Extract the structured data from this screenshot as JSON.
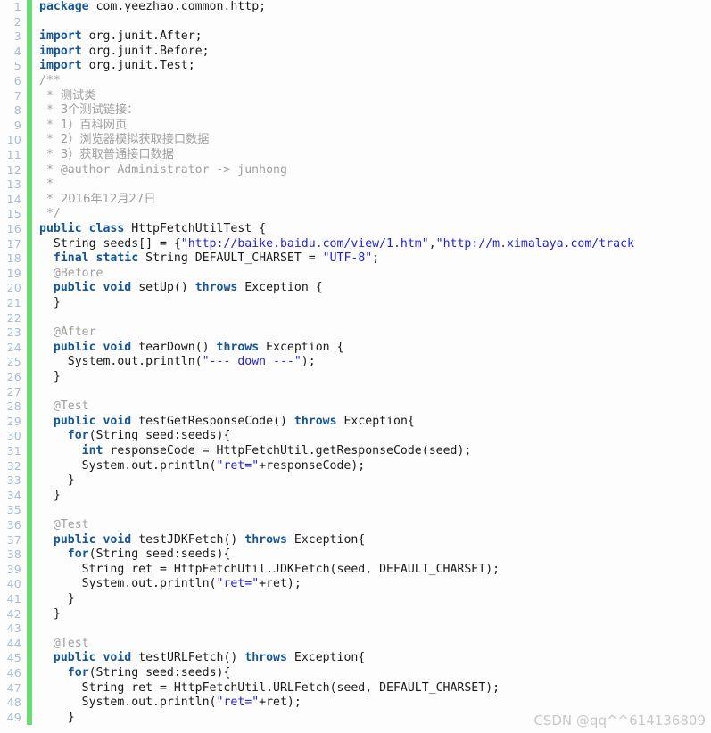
{
  "editor": {
    "language": "java",
    "gutter_accent_color": "#6bdc72",
    "background_color": "#fdfdfd",
    "line_number_color": "#a8bdd0",
    "keyword_color": "#14559a",
    "string_color": "#2121e8",
    "comment_color": "#a0a0a0",
    "text_color": "#1a1a1a",
    "first_line": 1,
    "last_line": 49
  },
  "watermark": {
    "text": "CSDN @qq^^614136809"
  },
  "lines": [
    {
      "n": "1",
      "tokens": [
        {
          "t": "kw",
          "v": "package"
        },
        {
          "t": "plain",
          "v": " com.yeezhao.common.http;"
        }
      ]
    },
    {
      "n": "2",
      "tokens": [
        {
          "t": "plain",
          "v": ""
        }
      ]
    },
    {
      "n": "3",
      "tokens": [
        {
          "t": "kw",
          "v": "import"
        },
        {
          "t": "plain",
          "v": " org.junit.After;"
        }
      ]
    },
    {
      "n": "4",
      "tokens": [
        {
          "t": "kw",
          "v": "import"
        },
        {
          "t": "plain",
          "v": " org.junit.Before;"
        }
      ]
    },
    {
      "n": "5",
      "tokens": [
        {
          "t": "kw",
          "v": "import"
        },
        {
          "t": "plain",
          "v": " org.junit.Test;"
        }
      ]
    },
    {
      "n": "6",
      "tokens": [
        {
          "t": "comment",
          "v": "/**"
        }
      ]
    },
    {
      "n": "7",
      "tokens": [
        {
          "t": "comment",
          "v": " * "
        },
        {
          "t": "comment-cjk",
          "v": "测试类"
        }
      ]
    },
    {
      "n": "8",
      "tokens": [
        {
          "t": "comment",
          "v": " * "
        },
        {
          "t": "comment-cjk",
          "v": "3个测试链接："
        }
      ]
    },
    {
      "n": "9",
      "tokens": [
        {
          "t": "comment",
          "v": " * "
        },
        {
          "t": "comment-cjk",
          "v": "1）百科网页"
        }
      ]
    },
    {
      "n": "10",
      "tokens": [
        {
          "t": "comment",
          "v": " * "
        },
        {
          "t": "comment-cjk",
          "v": "2）浏览器模拟获取接口数据"
        }
      ]
    },
    {
      "n": "11",
      "tokens": [
        {
          "t": "comment",
          "v": " * "
        },
        {
          "t": "comment-cjk",
          "v": "3）获取普通接口数据"
        }
      ]
    },
    {
      "n": "12",
      "tokens": [
        {
          "t": "comment",
          "v": " * @author Administrator -> junhong"
        }
      ]
    },
    {
      "n": "13",
      "tokens": [
        {
          "t": "comment",
          "v": " *"
        }
      ]
    },
    {
      "n": "14",
      "tokens": [
        {
          "t": "comment",
          "v": " * "
        },
        {
          "t": "comment-cjk",
          "v": "2016年12月27日"
        }
      ]
    },
    {
      "n": "15",
      "tokens": [
        {
          "t": "comment",
          "v": " */"
        }
      ]
    },
    {
      "n": "16",
      "tokens": [
        {
          "t": "kw",
          "v": "public"
        },
        {
          "t": "plain",
          "v": " "
        },
        {
          "t": "kw",
          "v": "class"
        },
        {
          "t": "plain",
          "v": " HttpFetchUtilTest {"
        }
      ]
    },
    {
      "n": "17",
      "tokens": [
        {
          "t": "plain",
          "v": "  String seeds[] = {"
        },
        {
          "t": "str",
          "v": "\"http://baike.baidu.com/view/1.htm\""
        },
        {
          "t": "plain",
          "v": ","
        },
        {
          "t": "str",
          "v": "\"http://m.ximalaya.com/track"
        }
      ]
    },
    {
      "n": "18",
      "tokens": [
        {
          "t": "plain",
          "v": "  "
        },
        {
          "t": "kw",
          "v": "final"
        },
        {
          "t": "plain",
          "v": " "
        },
        {
          "t": "kw",
          "v": "static"
        },
        {
          "t": "plain",
          "v": " String DEFAULT_CHARSET = "
        },
        {
          "t": "str",
          "v": "\"UTF-8\""
        },
        {
          "t": "plain",
          "v": ";"
        }
      ]
    },
    {
      "n": "19",
      "tokens": [
        {
          "t": "anno",
          "v": "  @Before"
        }
      ]
    },
    {
      "n": "20",
      "tokens": [
        {
          "t": "plain",
          "v": "  "
        },
        {
          "t": "kw",
          "v": "public"
        },
        {
          "t": "plain",
          "v": " "
        },
        {
          "t": "kw",
          "v": "void"
        },
        {
          "t": "plain",
          "v": " setUp() "
        },
        {
          "t": "kw",
          "v": "throws"
        },
        {
          "t": "plain",
          "v": " Exception {"
        }
      ]
    },
    {
      "n": "21",
      "tokens": [
        {
          "t": "plain",
          "v": "  }"
        }
      ]
    },
    {
      "n": "22",
      "tokens": [
        {
          "t": "plain",
          "v": ""
        }
      ]
    },
    {
      "n": "23",
      "tokens": [
        {
          "t": "anno",
          "v": "  @After"
        }
      ]
    },
    {
      "n": "24",
      "tokens": [
        {
          "t": "plain",
          "v": "  "
        },
        {
          "t": "kw",
          "v": "public"
        },
        {
          "t": "plain",
          "v": " "
        },
        {
          "t": "kw",
          "v": "void"
        },
        {
          "t": "plain",
          "v": " tearDown() "
        },
        {
          "t": "kw",
          "v": "throws"
        },
        {
          "t": "plain",
          "v": " Exception {"
        }
      ]
    },
    {
      "n": "25",
      "tokens": [
        {
          "t": "plain",
          "v": "    System.out.println("
        },
        {
          "t": "str",
          "v": "\"--- down ---\""
        },
        {
          "t": "plain",
          "v": ");"
        }
      ]
    },
    {
      "n": "26",
      "tokens": [
        {
          "t": "plain",
          "v": "  }"
        }
      ]
    },
    {
      "n": "27",
      "tokens": [
        {
          "t": "plain",
          "v": ""
        }
      ]
    },
    {
      "n": "28",
      "tokens": [
        {
          "t": "anno",
          "v": "  @Test"
        }
      ]
    },
    {
      "n": "29",
      "tokens": [
        {
          "t": "plain",
          "v": "  "
        },
        {
          "t": "kw",
          "v": "public"
        },
        {
          "t": "plain",
          "v": " "
        },
        {
          "t": "kw",
          "v": "void"
        },
        {
          "t": "plain",
          "v": " testGetResponseCode() "
        },
        {
          "t": "kw",
          "v": "throws"
        },
        {
          "t": "plain",
          "v": " Exception{"
        }
      ]
    },
    {
      "n": "30",
      "tokens": [
        {
          "t": "plain",
          "v": "    "
        },
        {
          "t": "kw",
          "v": "for"
        },
        {
          "t": "plain",
          "v": "(String seed:seeds){"
        }
      ]
    },
    {
      "n": "31",
      "tokens": [
        {
          "t": "plain",
          "v": "      "
        },
        {
          "t": "kw",
          "v": "int"
        },
        {
          "t": "plain",
          "v": " responseCode = HttpFetchUtil.getResponseCode(seed);"
        }
      ]
    },
    {
      "n": "32",
      "tokens": [
        {
          "t": "plain",
          "v": "      System.out.println("
        },
        {
          "t": "str",
          "v": "\"ret=\""
        },
        {
          "t": "plain",
          "v": "+responseCode);"
        }
      ]
    },
    {
      "n": "33",
      "tokens": [
        {
          "t": "plain",
          "v": "    }"
        }
      ]
    },
    {
      "n": "34",
      "tokens": [
        {
          "t": "plain",
          "v": "  }"
        }
      ]
    },
    {
      "n": "35",
      "tokens": [
        {
          "t": "plain",
          "v": ""
        }
      ]
    },
    {
      "n": "36",
      "tokens": [
        {
          "t": "anno",
          "v": "  @Test"
        }
      ]
    },
    {
      "n": "37",
      "tokens": [
        {
          "t": "plain",
          "v": "  "
        },
        {
          "t": "kw",
          "v": "public"
        },
        {
          "t": "plain",
          "v": " "
        },
        {
          "t": "kw",
          "v": "void"
        },
        {
          "t": "plain",
          "v": " testJDKFetch() "
        },
        {
          "t": "kw",
          "v": "throws"
        },
        {
          "t": "plain",
          "v": " Exception{"
        }
      ]
    },
    {
      "n": "38",
      "tokens": [
        {
          "t": "plain",
          "v": "    "
        },
        {
          "t": "kw",
          "v": "for"
        },
        {
          "t": "plain",
          "v": "(String seed:seeds){"
        }
      ]
    },
    {
      "n": "39",
      "tokens": [
        {
          "t": "plain",
          "v": "      String ret = HttpFetchUtil.JDKFetch(seed, DEFAULT_CHARSET);"
        }
      ]
    },
    {
      "n": "40",
      "tokens": [
        {
          "t": "plain",
          "v": "      System.out.println("
        },
        {
          "t": "str",
          "v": "\"ret=\""
        },
        {
          "t": "plain",
          "v": "+ret);"
        }
      ]
    },
    {
      "n": "41",
      "tokens": [
        {
          "t": "plain",
          "v": "    }"
        }
      ]
    },
    {
      "n": "42",
      "tokens": [
        {
          "t": "plain",
          "v": "  }"
        }
      ]
    },
    {
      "n": "43",
      "tokens": [
        {
          "t": "plain",
          "v": ""
        }
      ]
    },
    {
      "n": "44",
      "tokens": [
        {
          "t": "anno",
          "v": "  @Test"
        }
      ]
    },
    {
      "n": "45",
      "tokens": [
        {
          "t": "plain",
          "v": "  "
        },
        {
          "t": "kw",
          "v": "public"
        },
        {
          "t": "plain",
          "v": " "
        },
        {
          "t": "kw",
          "v": "void"
        },
        {
          "t": "plain",
          "v": " testURLFetch() "
        },
        {
          "t": "kw",
          "v": "throws"
        },
        {
          "t": "plain",
          "v": " Exception{"
        }
      ]
    },
    {
      "n": "46",
      "tokens": [
        {
          "t": "plain",
          "v": "    "
        },
        {
          "t": "kw",
          "v": "for"
        },
        {
          "t": "plain",
          "v": "(String seed:seeds){"
        }
      ]
    },
    {
      "n": "47",
      "tokens": [
        {
          "t": "plain",
          "v": "      String ret = HttpFetchUtil.URLFetch(seed, DEFAULT_CHARSET);"
        }
      ]
    },
    {
      "n": "48",
      "tokens": [
        {
          "t": "plain",
          "v": "      System.out.println("
        },
        {
          "t": "str",
          "v": "\"ret=\""
        },
        {
          "t": "plain",
          "v": "+ret);"
        }
      ]
    },
    {
      "n": "49",
      "tokens": [
        {
          "t": "plain",
          "v": "    }"
        }
      ]
    }
  ]
}
